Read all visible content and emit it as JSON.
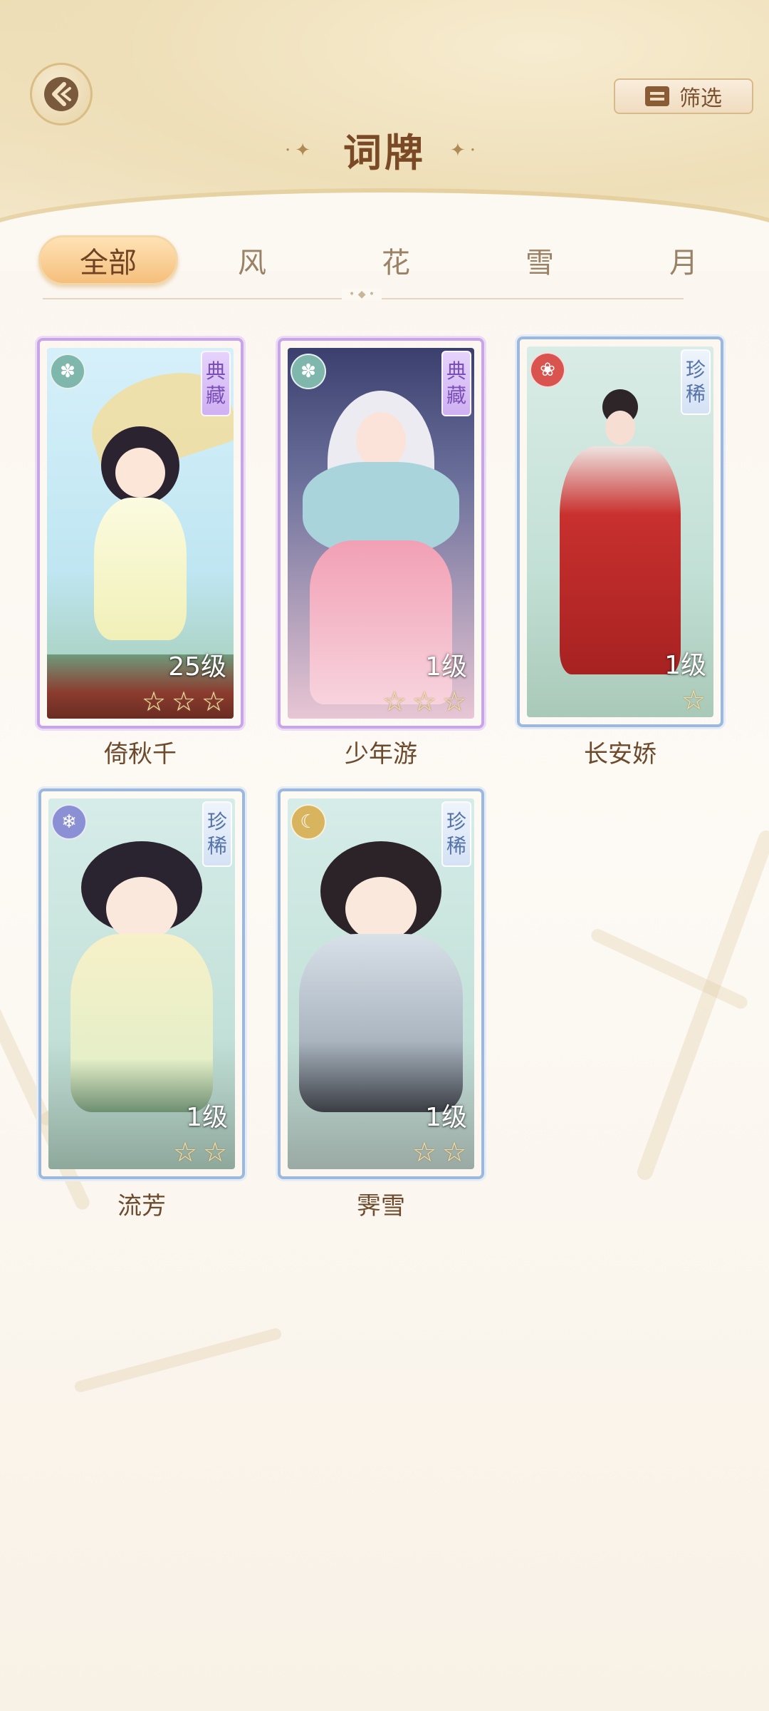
{
  "header": {
    "title": "词牌",
    "filter_label": "筛选"
  },
  "tabs": [
    {
      "label": "全部",
      "active": true
    },
    {
      "label": "风",
      "active": false
    },
    {
      "label": "花",
      "active": false
    },
    {
      "label": "雪",
      "active": false
    },
    {
      "label": "月",
      "active": false
    }
  ],
  "cards": [
    {
      "name": "倚秋千",
      "level": "25级",
      "rarity": "典藏",
      "rarity_line1": "典",
      "rarity_line2": "藏",
      "stars": 3,
      "attribute": "wind-icon"
    },
    {
      "name": "少年游",
      "level": "1级",
      "rarity": "典藏",
      "rarity_line1": "典",
      "rarity_line2": "藏",
      "stars": 3,
      "attribute": "wind-icon"
    },
    {
      "name": "长安娇",
      "level": "1级",
      "rarity": "珍稀",
      "rarity_line1": "珍",
      "rarity_line2": "稀",
      "stars": 1,
      "attribute": "flower-icon"
    },
    {
      "name": "流芳",
      "level": "1级",
      "rarity": "珍稀",
      "rarity_line1": "珍",
      "rarity_line2": "稀",
      "stars": 2,
      "attribute": "snow-icon"
    },
    {
      "name": "霁雪",
      "level": "1级",
      "rarity": "珍稀",
      "rarity_line1": "珍",
      "rarity_line2": "稀",
      "stars": 2,
      "attribute": "moon-icon"
    }
  ],
  "colors": {
    "accent_tab": "#f5bf7c",
    "title": "#7a4a26",
    "rarity_dian": "#cfb0f2",
    "rarity_zhen": "#d4e2f4"
  }
}
